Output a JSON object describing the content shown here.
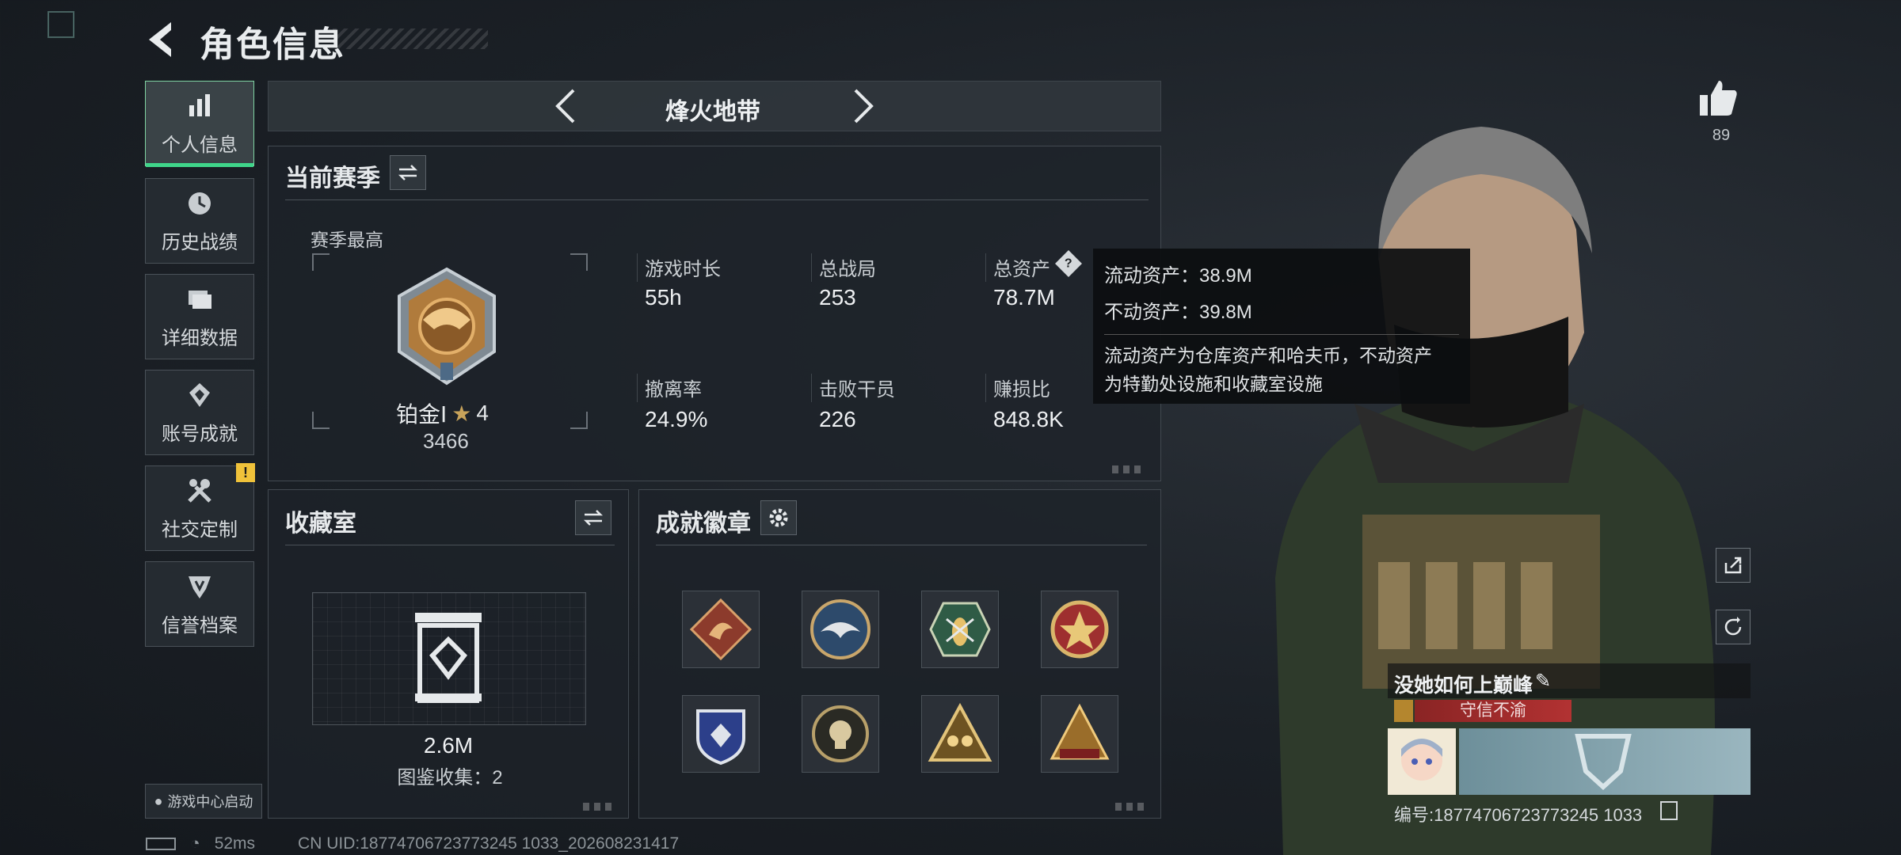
{
  "header": {
    "title": "角色信息"
  },
  "sidebar": {
    "items": [
      {
        "label": "个人信息",
        "icon": "bar-chart-icon"
      },
      {
        "label": "历史战绩",
        "icon": "clock-icon"
      },
      {
        "label": "详细数据",
        "icon": "folder-icon"
      },
      {
        "label": "账号成就",
        "icon": "achievement-icon"
      },
      {
        "label": "社交定制",
        "icon": "tools-icon"
      },
      {
        "label": "信誉档案",
        "icon": "shield-icon"
      }
    ],
    "warn_badge": "!",
    "game_center_label": "游戏中心启动"
  },
  "mode": {
    "name": "烽火地带"
  },
  "season": {
    "title": "当前赛季",
    "best_label": "赛季最高",
    "rank_name": "铂金Ⅰ",
    "rank_stars": "4",
    "rank_points": "3466",
    "stats": [
      {
        "label": "游戏时长",
        "value": "55h"
      },
      {
        "label": "总战局",
        "value": "253"
      },
      {
        "label": "总资产",
        "value": "78.7M"
      },
      {
        "label": "撤离率",
        "value": "24.9%"
      },
      {
        "label": "击败干员",
        "value": "226"
      },
      {
        "label": "赚损比",
        "value": "848.8K"
      }
    ]
  },
  "tooltip": {
    "liquid": "流动资产：38.9M",
    "fixed": "不动资产：39.8M",
    "desc_line1": "流动资产为仓库资产和哈夫币，不动资产",
    "desc_line2": "为特勤处设施和收藏室设施"
  },
  "collection": {
    "title": "收藏室",
    "value": "2.6M",
    "gallery": "图鉴收集：2"
  },
  "badges": {
    "title": "成就徽章",
    "items": [
      "dragon-badge",
      "eagle-badge",
      "wasp-badge",
      "star-medal-badge",
      "police-badge",
      "skull-badge",
      "squad-badge",
      "pyramid-badge"
    ]
  },
  "profile": {
    "likes": "89",
    "name": "没她如何上巅峰",
    "title": "守信不渝",
    "uid": "编号:18774706723773245 1033"
  },
  "footer": {
    "ping": "52ms",
    "uid": "CN UID:18774706723773245 1033_202608231417"
  },
  "colors": {
    "accent": "#3fd58a",
    "warn": "#f0c23a",
    "title_red": "#b23232"
  }
}
